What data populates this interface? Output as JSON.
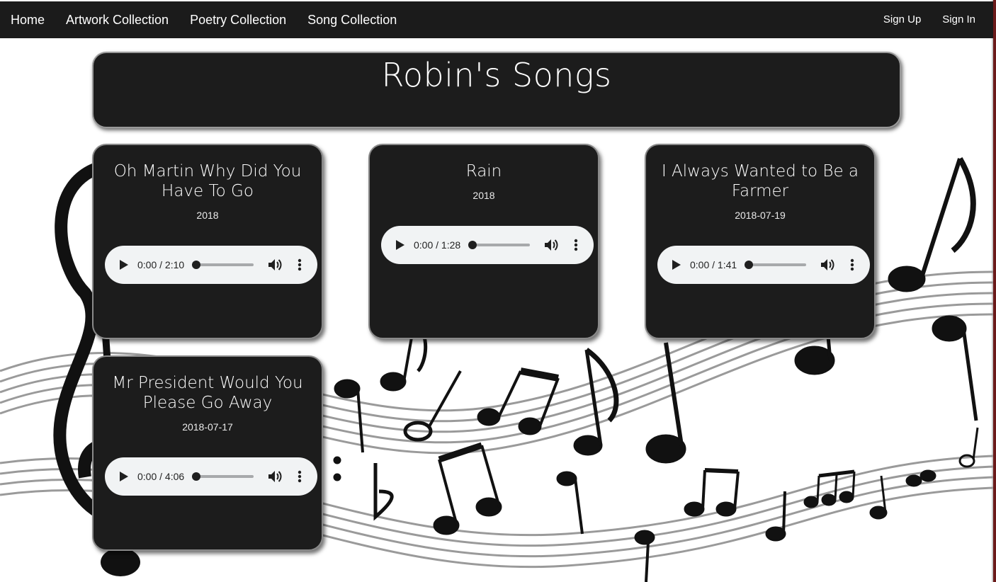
{
  "nav": {
    "links": [
      "Home",
      "Artwork Collection",
      "Poetry Collection",
      "Song Collection"
    ],
    "right": [
      "Sign Up",
      "Sign In"
    ]
  },
  "header": {
    "title": "Robin's Songs"
  },
  "songs": [
    {
      "title": "Oh Martin Why Did You Have To Go",
      "date": "2018",
      "time": "0:00 / 2:10"
    },
    {
      "title": "Rain",
      "date": "2018",
      "time": "0:00 / 1:28"
    },
    {
      "title": "I Always Wanted to Be a Farmer",
      "date": "2018-07-19",
      "time": "0:00 / 1:41"
    },
    {
      "title": "Mr President Would You Please Go Away",
      "date": "2018-07-17",
      "time": "0:00 / 4:06"
    }
  ],
  "icons": {
    "play": "play-icon",
    "volume": "volume-icon",
    "menu": "more-options-icon"
  },
  "colors": {
    "nav_bg": "#1b1b1b",
    "card_bg": "#1c1c1c",
    "player_bg": "#f1f3f4"
  }
}
